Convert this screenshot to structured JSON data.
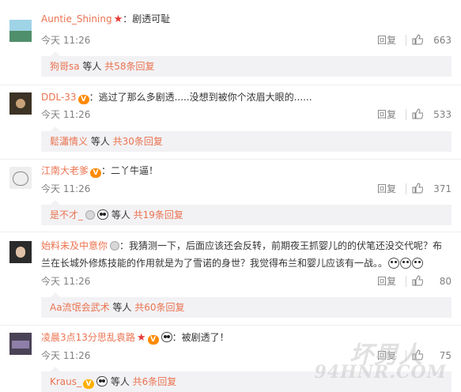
{
  "comments": [
    {
      "user": "Auntie_Shining",
      "text": "：剧透可耻",
      "time": "今天 11:26",
      "reply_label": "回复",
      "likes": "663",
      "sub": {
        "user": "狗哥sa",
        "mid": " 等人 ",
        "more": "共58条回复"
      }
    },
    {
      "user": "DDL-33",
      "text": "：逃过了那么多剧透.....没想到被你个浓眉大眼的......",
      "time": "今天 11:26",
      "reply_label": "回复",
      "likes": "533",
      "sub": {
        "user": "鬆瀟情义",
        "mid": " 等人 ",
        "more": "共30条回复"
      }
    },
    {
      "user": "江南大老爹",
      "text": "：二丫牛逼！",
      "time": "今天 11:26",
      "reply_label": "回复",
      "likes": "371",
      "sub": {
        "user": "是不才_",
        "mid": " 等人 ",
        "more": "共19条回复"
      }
    },
    {
      "user": "始料未及中意你",
      "text_line1": "：我猜测一下，后面应该还会反转，前期夜王抓婴儿的的伏笔还没交代呢？布",
      "text_line2": "兰在长城外修炼技能的作用就是为了雪诺的身世？我觉得布兰和婴儿应该有一战。。",
      "time": "今天 11:26",
      "reply_label": "回复",
      "likes": "80",
      "sub": {
        "user": "Aa流氓会武术",
        "mid": " 等人 ",
        "more": "共60条回复"
      }
    },
    {
      "user": "凌晨3点13分思乱袁路",
      "text": "：被剧透了！",
      "time": "今天 11:26",
      "reply_label": "回复",
      "likes": "75",
      "sub": {
        "user": "Kraus_",
        "mid": " 等人 ",
        "more": "共6条回复"
      }
    }
  ],
  "watermark": {
    "top": "坏男人",
    "bottom": "94HNR.COM"
  },
  "colors": {
    "link": "#eb7350",
    "meta": "#808080",
    "subbox": "#f2f2f5"
  }
}
